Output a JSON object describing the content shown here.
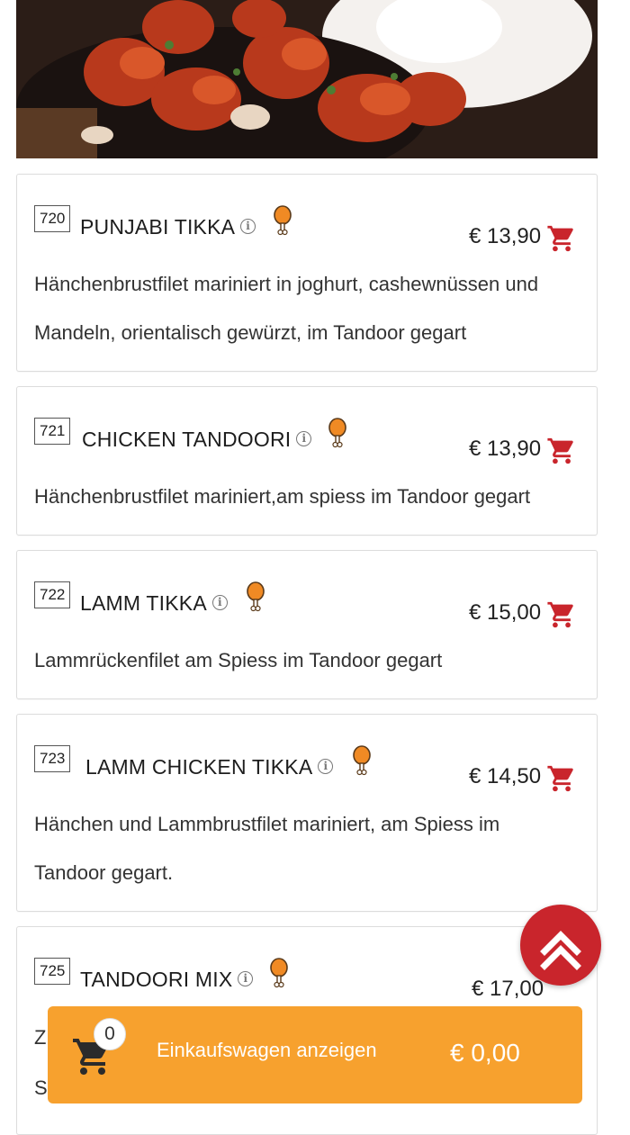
{
  "menu_items": [
    {
      "number": "720",
      "name": "PUNJABI TIKKA",
      "price": "€ 13,90",
      "desc_lines": [
        "Hänchenbrustfilet mariniert in joghurt, cashewnüssen und",
        "Mandeln, orientalisch gewürzt, im Tandoor gegart"
      ]
    },
    {
      "number": "721",
      "name": "CHICKEN TANDOORI",
      "price": "€ 13,90",
      "desc_lines": [
        "Hänchenbrustfilet mariniert,am spiess im Tandoor gegart"
      ]
    },
    {
      "number": "722",
      "name": "LAMM TIKKA",
      "price": "€ 15,00",
      "desc_lines": [
        "Lammrückenfilet am Spiess im Tandoor gegart"
      ]
    },
    {
      "number": "723",
      "name": "LAMM CHICKEN TIKKA",
      "price": "€ 14,50",
      "desc_lines": [
        "Hänchen und Lammbrustfilet mariniert, am Spiess im",
        "Tandoor gegart."
      ]
    },
    {
      "number": "725",
      "name": "TANDOORI MIX",
      "price": "€ 17,00",
      "desc_lines": [
        "Z",
        "S"
      ]
    }
  ],
  "info_glyph": "i",
  "cart_bar": {
    "count": "0",
    "label": "Einkaufswagen anzeigen",
    "total": "€ 0,00"
  },
  "colors": {
    "accent_red": "#c9252c",
    "cart_bar": "#f7a12e",
    "drumstick": "#f08a24"
  },
  "icons": {
    "info": "info-icon",
    "chicken": "chicken-leg-icon",
    "cart": "shopping-cart-icon",
    "scroll_top": "double-chevron-up-icon"
  }
}
